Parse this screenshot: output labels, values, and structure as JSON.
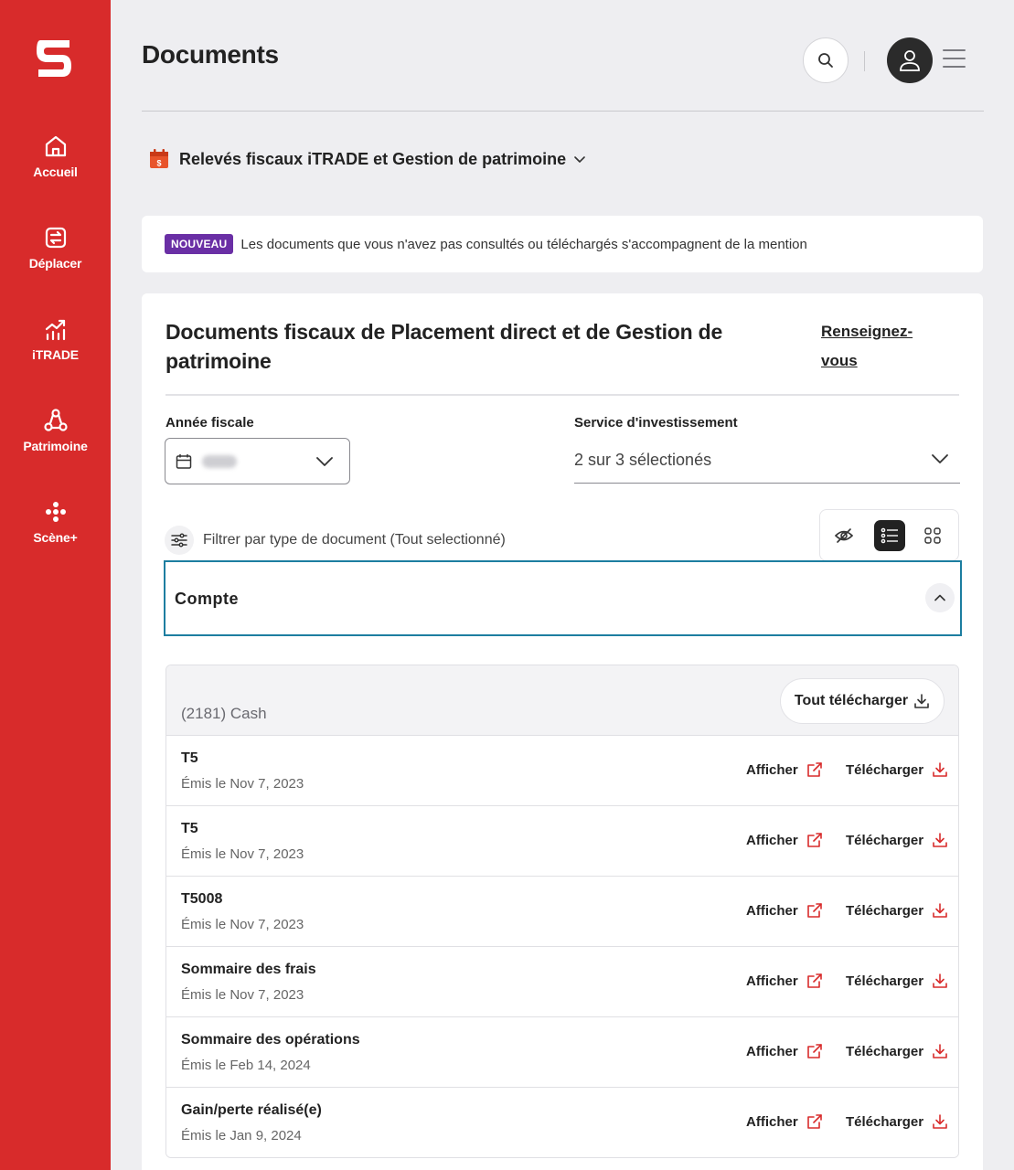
{
  "sidebar": {
    "items": [
      {
        "label": "Accueil",
        "icon": "home-icon"
      },
      {
        "label": "Déplacer",
        "icon": "transfer-icon"
      },
      {
        "label": "iTRADE",
        "icon": "chart-icon"
      },
      {
        "label": "Patrimoine",
        "icon": "wealth-icon"
      },
      {
        "label": "Scène+",
        "icon": "scene-plus-icon"
      }
    ]
  },
  "header": {
    "title": "Documents"
  },
  "doc_type": {
    "label": "Relevés fiscaux iTRADE et Gestion de patrimoine"
  },
  "notice": {
    "badge": "NOUVEAU",
    "text": "Les documents que vous n'avez pas consultés ou téléchargés s'accompagnent de la mention"
  },
  "card": {
    "title": "Documents fiscaux de Placement direct et de Gestion de patrimoine",
    "learn_more": "Renseignez-vous",
    "year_label": "Année fiscale",
    "service_label": "Service d'investissement",
    "service_value": "2 sur 3 sélectionés",
    "filter_label": "Filtrer par type de document (Tout selectionné)",
    "account_section": "Compte"
  },
  "account": {
    "name": "(2181) Cash",
    "download_all": "Tout télécharger",
    "view_label": "Afficher",
    "download_label": "Télécharger",
    "documents": [
      {
        "name": "T5",
        "date": "Émis le Nov 7, 2023"
      },
      {
        "name": "T5",
        "date": "Émis le Nov 7, 2023"
      },
      {
        "name": "T5008",
        "date": "Émis le Nov 7, 2023"
      },
      {
        "name": "Sommaire des frais",
        "date": "Émis le Nov 7, 2023"
      },
      {
        "name": "Sommaire des opérations",
        "date": "Émis le Feb 14, 2024"
      },
      {
        "name": "Gain/perte réalisé(e)",
        "date": "Émis le Jan 9, 2024"
      }
    ]
  },
  "colors": {
    "brand_red": "#d82b2b",
    "badge_purple": "#6a2fa5",
    "focus_teal": "#1d7ea0",
    "action_red": "#d82b2b"
  }
}
